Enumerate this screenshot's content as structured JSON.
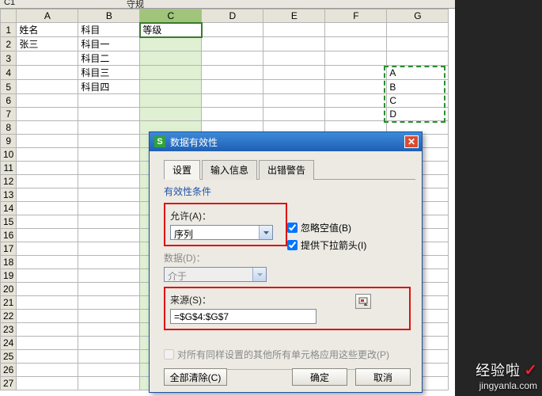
{
  "formula_bar": {
    "cellref": "C1",
    "value": "守规"
  },
  "columns": [
    "A",
    "B",
    "C",
    "D",
    "E",
    "F",
    "G"
  ],
  "rows_count": 27,
  "cells": {
    "A1": "姓名",
    "A2": "张三",
    "B1": "科目",
    "B2": "科目一",
    "B3": "科目二",
    "B4": "科目三",
    "B5": "科目四",
    "C1": "等级",
    "G4": "A",
    "G5": "B",
    "G6": "C",
    "G7": "D"
  },
  "marquee": {
    "col": "G",
    "row_start": 4,
    "row_end": 7
  },
  "dialog": {
    "title": "数据有效性",
    "tabs": [
      "设置",
      "输入信息",
      "出错警告"
    ],
    "active_tab": 0,
    "group_label": "有效性条件",
    "allow_label": "允许(A)：",
    "allow_value": "序列",
    "data_label": "数据(D)：",
    "data_value": "介于",
    "ignore_blank_label": "忽略空值(B)",
    "ignore_blank_checked": true,
    "dropdown_label": "提供下拉箭头(I)",
    "dropdown_checked": true,
    "source_label": "来源(S)：",
    "source_value": "=$G$4:$G$7",
    "apply_label": "对所有同样设置的其他所有单元格应用这些更改(P)",
    "apply_checked": false,
    "clear_button": "全部清除(C)",
    "ok_button": "确定",
    "cancel_button": "取消"
  },
  "watermark": {
    "line1": "经验啦",
    "mark": "✓",
    "url": "jingyanla.com"
  }
}
